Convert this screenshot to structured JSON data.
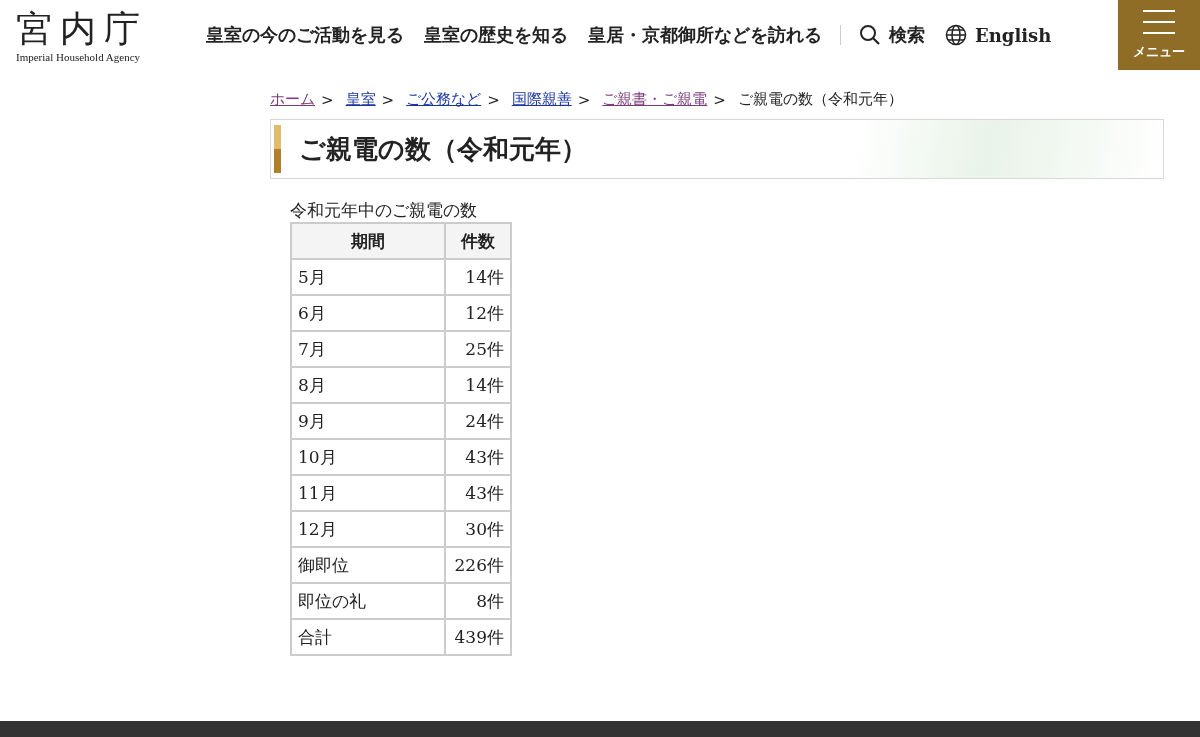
{
  "header": {
    "logo": "宮内庁",
    "logo_subtitle": "Imperial Household Agency",
    "nav": [
      "皇室の今のご活動を見る",
      "皇室の歴史を知る",
      "皇居・京都御所などを訪れる"
    ],
    "search": "検索",
    "language": "English",
    "menu": "メニュー"
  },
  "breadcrumb": {
    "links": [
      {
        "label": "ホーム",
        "visited": true
      },
      {
        "label": "皇室",
        "visited": false
      },
      {
        "label": "ご公務など",
        "visited": false
      },
      {
        "label": "国際親善",
        "visited": false
      },
      {
        "label": "ご親書・ご親電",
        "visited": true
      }
    ],
    "separator": ">",
    "current": "ご親電の数（令和元年）"
  },
  "page_title": "ご親電の数（令和元年）",
  "table": {
    "caption": "令和元年中のご親電の数",
    "columns": [
      "期間",
      "件数"
    ],
    "rows": [
      [
        "5月",
        "14件"
      ],
      [
        "6月",
        "12件"
      ],
      [
        "7月",
        "25件"
      ],
      [
        "8月",
        "14件"
      ],
      [
        "9月",
        "24件"
      ],
      [
        "10月",
        "43件"
      ],
      [
        "11月",
        "43件"
      ],
      [
        "12月",
        "30件"
      ],
      [
        "御即位",
        "226件"
      ],
      [
        "即位の礼",
        "8件"
      ],
      [
        "合計",
        "439件"
      ]
    ]
  }
}
